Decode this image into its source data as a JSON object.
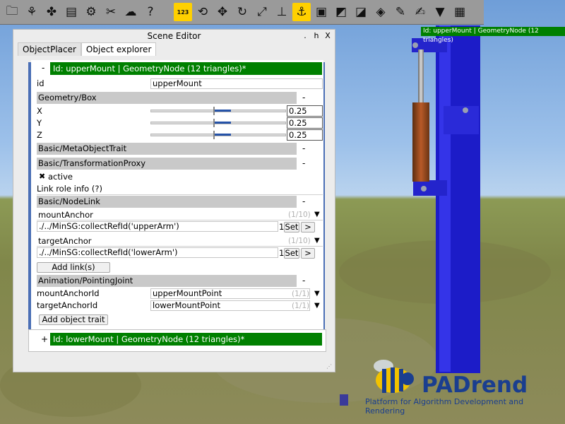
{
  "toolbar": {
    "icons": [
      {
        "name": "folder-icon",
        "glyph": "🗀"
      },
      {
        "name": "tree-icon",
        "glyph": "⚘"
      },
      {
        "name": "puzzle-icon",
        "glyph": "✤"
      },
      {
        "name": "list-icon",
        "glyph": "▤"
      },
      {
        "name": "gear-icon",
        "glyph": "⚙"
      },
      {
        "name": "tools-icon",
        "glyph": "✂"
      },
      {
        "name": "weather-icon",
        "glyph": "☁"
      },
      {
        "name": "help-icon",
        "glyph": "?"
      }
    ],
    "transform_icons": [
      {
        "name": "numbers-icon",
        "glyph": "123"
      },
      {
        "name": "camera-rotate-icon",
        "glyph": "⟲"
      },
      {
        "name": "move-icon",
        "glyph": "✥"
      },
      {
        "name": "rotate-icon",
        "glyph": "↻"
      },
      {
        "name": "scale-icon",
        "glyph": "⤢"
      },
      {
        "name": "align-icon",
        "glyph": "⊥"
      },
      {
        "name": "anchor-icon",
        "glyph": "⚓"
      },
      {
        "name": "snap-icon",
        "glyph": "▣"
      },
      {
        "name": "edit-mesh-icon",
        "glyph": "◩"
      },
      {
        "name": "select-icon",
        "glyph": "◪"
      },
      {
        "name": "pick-icon",
        "glyph": "◈"
      },
      {
        "name": "draw-icon",
        "glyph": "✎"
      },
      {
        "name": "paint-icon",
        "glyph": "✍"
      },
      {
        "name": "filter-icon",
        "glyph": "▼"
      },
      {
        "name": "document-icon",
        "glyph": "▦"
      }
    ]
  },
  "window": {
    "title": "Scene Editor",
    "controls": [
      ".",
      "h",
      "X"
    ],
    "tabs": [
      "ObjectPlacer",
      "Object explorer"
    ]
  },
  "node1": {
    "expander": "-",
    "header": "Id: upperMount | GeometryNode (12 triangles)*",
    "id_label": "id",
    "id_value": "upperMount"
  },
  "geometry": {
    "section": "Geometry/Box",
    "x_label": "X",
    "x_value": "0.25",
    "y_label": "Y",
    "y_value": "0.25",
    "z_label": "Z",
    "z_value": "0.25"
  },
  "meta": {
    "section": "Basic/MetaObjectTrait",
    "collapse": "-"
  },
  "transform": {
    "section": "Basic/TransformationProxy",
    "collapse": "-",
    "active_label": "active",
    "active_mark": "✖"
  },
  "linkinfo": {
    "label": "Link role info (?)"
  },
  "nodelink": {
    "section": "Basic/NodeLink",
    "collapse": "-",
    "mount_anchor_label": "mountAnchor",
    "mount_anchor_count": "(1/10)",
    "mount_anchor_expr": "./../MinSG:collectRefId('upperArm')",
    "mount_anchor_num": "1",
    "target_anchor_label": "targetAnchor",
    "target_anchor_count": "(1/10)",
    "target_anchor_expr": "./../MinSG:collectRefId('lowerArm')",
    "target_anchor_num": "1",
    "set_label": "Set",
    "goto_label": ">",
    "add_links_label": "Add link(s)"
  },
  "joint": {
    "section": "Animation/PointingJoint",
    "collapse": "-",
    "mount_id_label": "mountAnchorId",
    "mount_id_value": "upperMountPoint",
    "mount_id_count": "(1/1)",
    "target_id_label": "targetAnchorId",
    "target_id_value": "lowerMountPoint",
    "target_id_count": "(1/1)"
  },
  "add_trait_label": "Add object trait",
  "node2": {
    "expander": "+",
    "header": "Id: lowerMount | GeometryNode (12 triangles)*"
  },
  "viewport": {
    "selection_label": "Id: upperMount | GeometryNode (12 triangles)",
    "logo": "PADrend",
    "logo_sub": "Platform for Algorithm Development and Rendering"
  },
  "colors": {
    "header_green": "#008000",
    "model_blue": "#1c1cc8",
    "active_tool": "#ffd000",
    "logo_blue": "#1a3e8f"
  }
}
